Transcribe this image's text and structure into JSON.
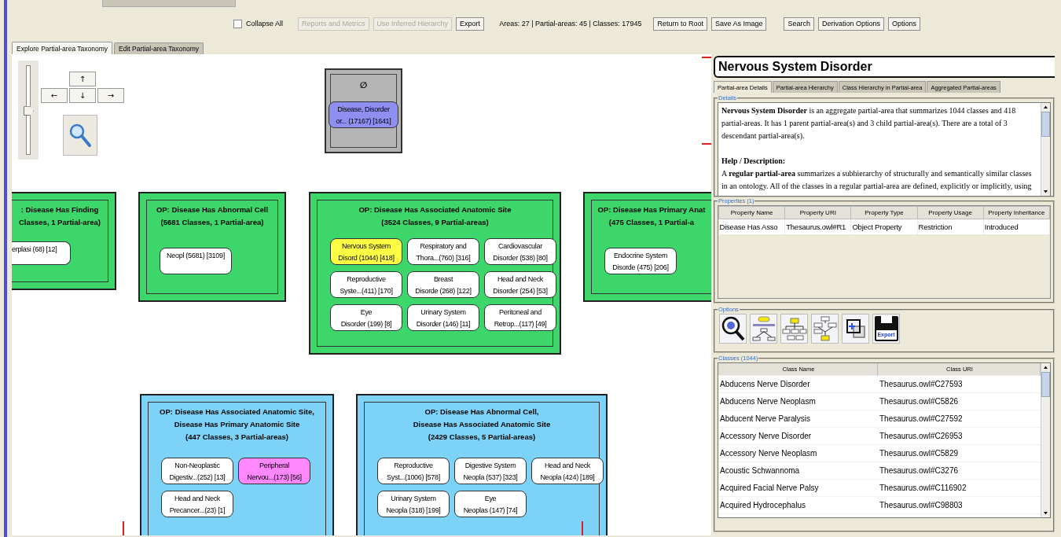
{
  "toolbar": {
    "collapse_all": {
      "label": "Collapse All",
      "checked": false
    },
    "buttons": [
      {
        "label": "Reports and Metrics",
        "disabled": true
      },
      {
        "label": "Use Inferred Hierarchy",
        "disabled": true
      },
      {
        "label": "Export",
        "disabled": false
      }
    ],
    "stats": "Areas: 27 | Partial-areas: 45 | Classes: 17945",
    "nav_buttons": [
      {
        "label": "Return to Root",
        "disabled": false
      },
      {
        "label": "Save As Image",
        "disabled": false
      }
    ],
    "tool_buttons": [
      {
        "label": "Search",
        "disabled": false
      },
      {
        "label": "Derivation Options",
        "disabled": false
      },
      {
        "label": "Options",
        "disabled": false
      }
    ]
  },
  "view_tabs": [
    {
      "label": "Explore Partial-area Taxonomy",
      "selected": true
    },
    {
      "label": "Edit Partial-area Taxonomy",
      "selected": false
    }
  ],
  "zoom": {
    "level": 0.48,
    "arrows": [
      "↑",
      "←",
      "↓",
      "→"
    ]
  },
  "root": {
    "symbol": "∅",
    "color": "#b4b4b4",
    "partial_areas": [
      {
        "label": "Disease, Disorder\nor... (17167) [1641]",
        "color": "#8f8ff2"
      }
    ]
  },
  "areas": [
    {
      "title": ": Disease Has Finding\nClasses, 1 Partial-area)",
      "color": "#3dd66a",
      "partial_areas": [
        {
          "label": "erplasi (68) [12]",
          "color": "#ffffff"
        }
      ]
    },
    {
      "title": "OP: Disease Has Abnormal Cell\n(5681 Classes, 1 Partial-area)",
      "color": "#3dd66a",
      "partial_areas": [
        {
          "label": "Neopl (5681) [3109]",
          "color": "#ffffff"
        }
      ]
    },
    {
      "title": "OP: Disease Has Associated Anatomic Site\n(3524 Classes, 9 Partial-areas)",
      "color": "#3dd66a",
      "partial_areas": [
        {
          "label": "Nervous System\nDisord (1044) [418]",
          "color": "#ffff44"
        },
        {
          "label": "Respiratory and\nThora...(760) [316]",
          "color": "#ffffff"
        },
        {
          "label": "Cardiovascular\nDisorder (538) [80]",
          "color": "#ffffff"
        },
        {
          "label": "Reproductive\nSyste...(411) [170]",
          "color": "#ffffff"
        },
        {
          "label": "Breast\nDisorde (268) [122]",
          "color": "#ffffff"
        },
        {
          "label": "Head and Neck\nDisorder (254) [53]",
          "color": "#ffffff"
        },
        {
          "label": "Eye\nDisorder (199) [8]",
          "color": "#ffffff"
        },
        {
          "label": "Urinary System\nDisorder (146) [11]",
          "color": "#ffffff"
        },
        {
          "label": "Peritoneal and\nRetrop...(117) [49]",
          "color": "#ffffff"
        }
      ]
    },
    {
      "title": "OP: Disease Has Primary Anat\n(475 Classes, 1 Partial-a",
      "color": "#3dd66a",
      "partial_areas": [
        {
          "label": "Endocrine System\nDisorde (475) [206]",
          "color": "#ffffff"
        }
      ]
    },
    {
      "title": "OP: Disease Has Associated Anatomic Site,\nDisease Has Primary Anatomic Site\n(447 Classes, 3 Partial-areas)",
      "color": "#7dd3f7",
      "partial_areas": [
        {
          "label": "Non-Neoplastic\nDigestiv...(252) [13]",
          "color": "#ffffff"
        },
        {
          "label": "Peripheral\nNervou...(173) [56]",
          "color": "#ff88ff"
        },
        {
          "label": "Head and Neck\nPrecancer...(23) [1]",
          "color": "#ffffff"
        }
      ]
    },
    {
      "title": "OP: Disease Has Abnormal Cell,\nDisease Has Associated Anatomic Site\n(2429 Classes, 5 Partial-areas)",
      "color": "#7dd3f7",
      "partial_areas": [
        {
          "label": "Reproductive\nSyst...(1006) [578]",
          "color": "#ffffff"
        },
        {
          "label": "Digestive System\nNeopla (537) [323]",
          "color": "#ffffff"
        },
        {
          "label": "Head and Neck\nNeopla (424) [189]",
          "color": "#ffffff"
        },
        {
          "label": "Urinary System\nNeopla (318) [199]",
          "color": "#ffffff"
        },
        {
          "label": "Eye\nNeoplas (147) [74]",
          "color": "#ffffff"
        }
      ]
    }
  ],
  "panel": {
    "title": "Nervous System Disorder",
    "tabs": [
      {
        "label": "Partial-area Details",
        "selected": true
      },
      {
        "label": "Partial-area Hierarchy",
        "selected": false
      },
      {
        "label": "Class Hierarchy in Partial-area",
        "selected": false
      },
      {
        "label": "Aggregated Partial-areas",
        "selected": false
      }
    ],
    "details": {
      "legend": "Details",
      "paragraphs": [
        {
          "kind": "text",
          "text": "**Nervous System Disorder** is an aggregate partial-area that summarizes 1044 classes and 418 partial-areas. It has 1 parent partial-area(s) and 3 child partial-area(s). There are a total of 3 descendant partial-area(s)."
        },
        {
          "kind": "heading",
          "text": "Help / Description:"
        },
        {
          "kind": "text",
          "text": "A **regular partial-area** summarizes a subhierarchy of structurally and semantically similar classes in an ontology. All of the classes in a regular partial-area are defined, explicitly or implicitly, using"
        }
      ]
    },
    "properties": {
      "legend": "Properties (1)",
      "columns": [
        "Property Name",
        "Property URI",
        "Property Type",
        "Property Usage",
        "Property Inheritance"
      ],
      "rows": [
        [
          "Disease Has Asso",
          "Thesaurus.owl#R1",
          "Object Property",
          "Restriction",
          "Introduced"
        ]
      ]
    },
    "options": {
      "legend": "Options",
      "buttons": [
        {
          "kind": "find-root"
        },
        {
          "kind": "export-aggregate"
        },
        {
          "kind": "hierarchy"
        },
        {
          "kind": "swap"
        },
        {
          "kind": "new-window"
        },
        {
          "kind": "export",
          "label": "Export"
        }
      ]
    },
    "classes": {
      "legend": "Classes (1044)",
      "columns": [
        "Class Name",
        "Class URI"
      ],
      "rows": [
        [
          "Abducens Nerve Disorder",
          "Thesaurus.owl#C27593"
        ],
        [
          "Abducens Nerve Neoplasm",
          "Thesaurus.owl#C5826"
        ],
        [
          "Abducent Nerve Paralysis",
          "Thesaurus.owl#C27592"
        ],
        [
          "Accessory Nerve Disorder",
          "Thesaurus.owl#C26953"
        ],
        [
          "Accessory Nerve Neoplasm",
          "Thesaurus.owl#C5829"
        ],
        [
          "Acoustic Schwannoma",
          "Thesaurus.owl#C3276"
        ],
        [
          "Acquired Facial Nerve Palsy",
          "Thesaurus.owl#C116902"
        ],
        [
          "Acquired Hydrocephalus",
          "Thesaurus.owl#C98803"
        ]
      ]
    }
  }
}
